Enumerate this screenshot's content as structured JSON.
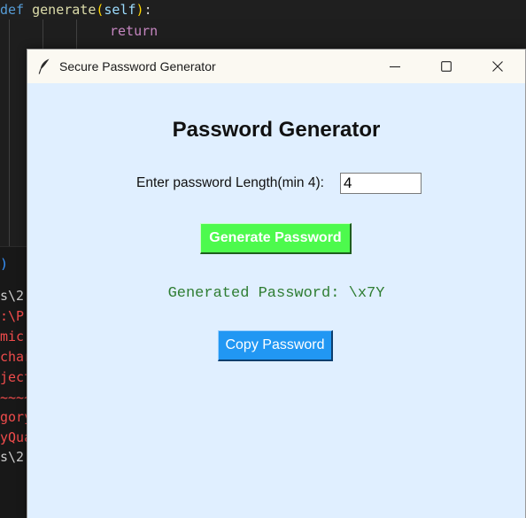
{
  "editor": {
    "line1": {
      "kw": "def",
      "fn": "generate",
      "open": "(",
      "param": "self",
      "close": ")",
      "colon": ":"
    },
    "line2": "return"
  },
  "terminal": {
    "lines": [
      {
        "text": ")",
        "color": "blue"
      },
      {
        "text": "s\\2",
        "color": "gray"
      },
      {
        "text": ":\\P",
        "color": "red"
      },
      {
        "text": "mic",
        "color": "red"
      },
      {
        "text": "char",
        "color": "red"
      },
      {
        "text": "ject",
        "color": "red"
      },
      {
        "text": "~~~~",
        "color": "red"
      },
      {
        "text": "gory",
        "color": "red"
      },
      {
        "text": "yQua",
        "color": "red"
      },
      {
        "text": "s\\2",
        "color": "gray"
      }
    ]
  },
  "window": {
    "title": "Secure Password Generator",
    "icon": "feather-icon",
    "background": "#e0efff",
    "controls": [
      "minimize-icon",
      "maximize-icon",
      "close-icon"
    ]
  },
  "app": {
    "heading": "Password Generator",
    "length_label": "Enter password Length(min 4):",
    "length_value": "4",
    "generate_label": "Generate Password",
    "generate_color": "#4dfa4d",
    "result_text": "Generated Password: \\x7Y",
    "result_color": "#2e7d32",
    "copy_label": "Copy Password",
    "copy_color": "#2197f3"
  }
}
